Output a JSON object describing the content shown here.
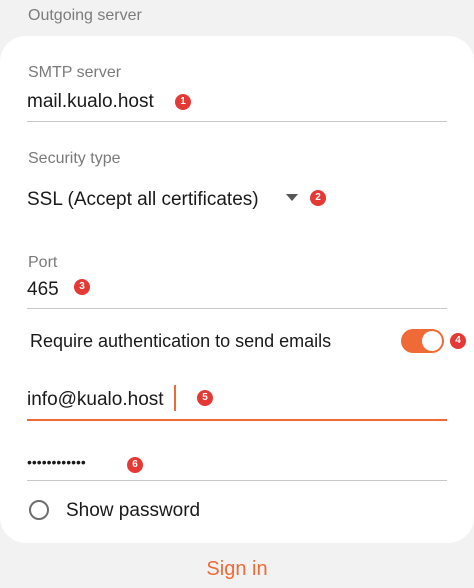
{
  "section": {
    "title": "Outgoing server"
  },
  "smtp": {
    "label": "SMTP server",
    "value": "mail.kualo.host",
    "badge": "1"
  },
  "security": {
    "label": "Security type",
    "value": "SSL (Accept all certificates)",
    "badge": "2",
    "icon": "dropdown-triangle"
  },
  "port": {
    "label": "Port",
    "value": "465",
    "badge": "3"
  },
  "auth": {
    "label": "Require authentication to send emails",
    "enabled": true,
    "badge": "4",
    "accent_color": "#ef6a36"
  },
  "username": {
    "value": "info@kualo.host",
    "badge": "5"
  },
  "password": {
    "value": "••••••••••••",
    "badge": "6"
  },
  "show_password": {
    "label": "Show password",
    "checked": false
  },
  "footer": {
    "sign_in_label": "Sign in"
  },
  "colors": {
    "accent": "#ef6a36",
    "badge": "#e53935"
  }
}
